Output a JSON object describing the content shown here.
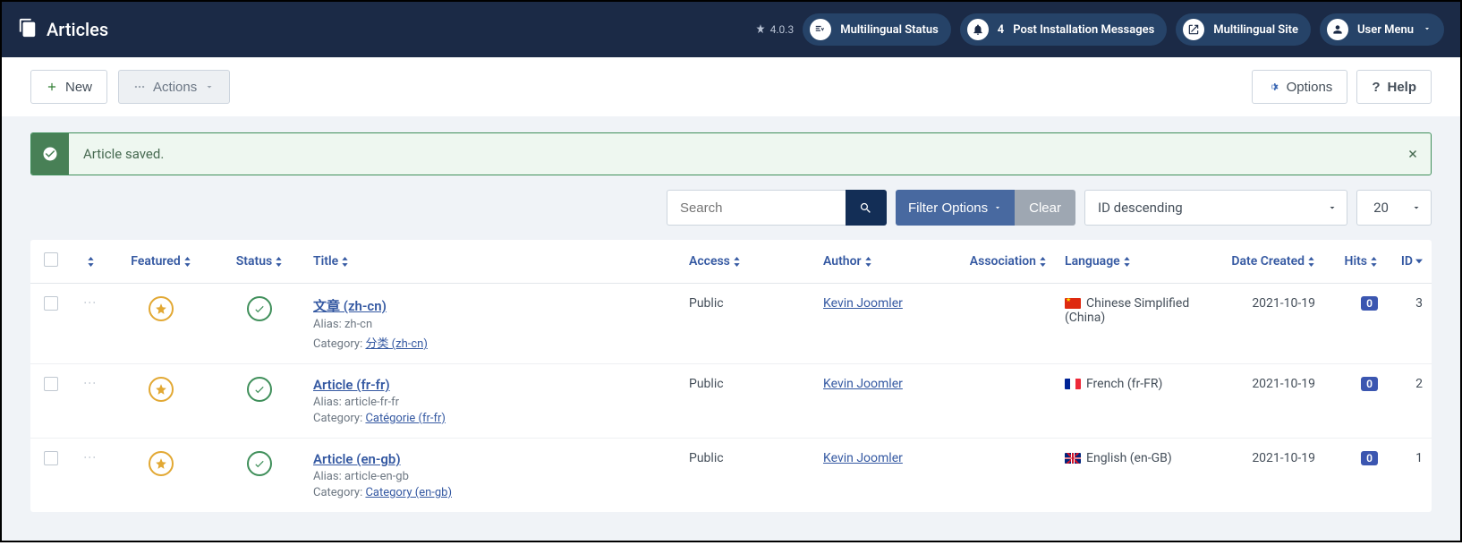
{
  "header": {
    "title": "Articles",
    "version": "4.0.3",
    "multilingual_status": "Multilingual Status",
    "notif_count": "4",
    "post_install": "Post Installation Messages",
    "multilingual_site": "Multilingual Site",
    "user_menu": "User Menu"
  },
  "toolbar": {
    "new": "New",
    "actions": "Actions",
    "options": "Options",
    "help": "Help"
  },
  "alert": {
    "message": "Article saved."
  },
  "filters": {
    "search_placeholder": "Search",
    "filter_options": "Filter Options",
    "clear": "Clear",
    "sort": "ID descending",
    "limit": "20"
  },
  "columns": {
    "featured": "Featured",
    "status": "Status",
    "title": "Title",
    "access": "Access",
    "author": "Author",
    "association": "Association",
    "language": "Language",
    "date_created": "Date Created",
    "hits": "Hits",
    "id": "ID"
  },
  "labels": {
    "alias": "Alias:",
    "category": "Category:"
  },
  "rows": [
    {
      "title": "文章 (zh-cn)",
      "alias": "zh-cn",
      "category": "分类 (zh-cn)",
      "access": "Public",
      "author": "Kevin Joomler",
      "language": "Chinese Simplified (China)",
      "flag": "cn",
      "date": "2021-10-19",
      "hits": "0",
      "id": "3"
    },
    {
      "title": "Article (fr-fr)",
      "alias": "article-fr-fr",
      "category": "Catégorie (fr-fr)",
      "access": "Public",
      "author": "Kevin Joomler",
      "language": "French (fr-FR)",
      "flag": "fr",
      "date": "2021-10-19",
      "hits": "0",
      "id": "2"
    },
    {
      "title": "Article (en-gb)",
      "alias": "article-en-gb",
      "category": "Category (en-gb)",
      "access": "Public",
      "author": "Kevin Joomler",
      "language": "English (en-GB)",
      "flag": "gb",
      "date": "2021-10-19",
      "hits": "0",
      "id": "1"
    }
  ]
}
